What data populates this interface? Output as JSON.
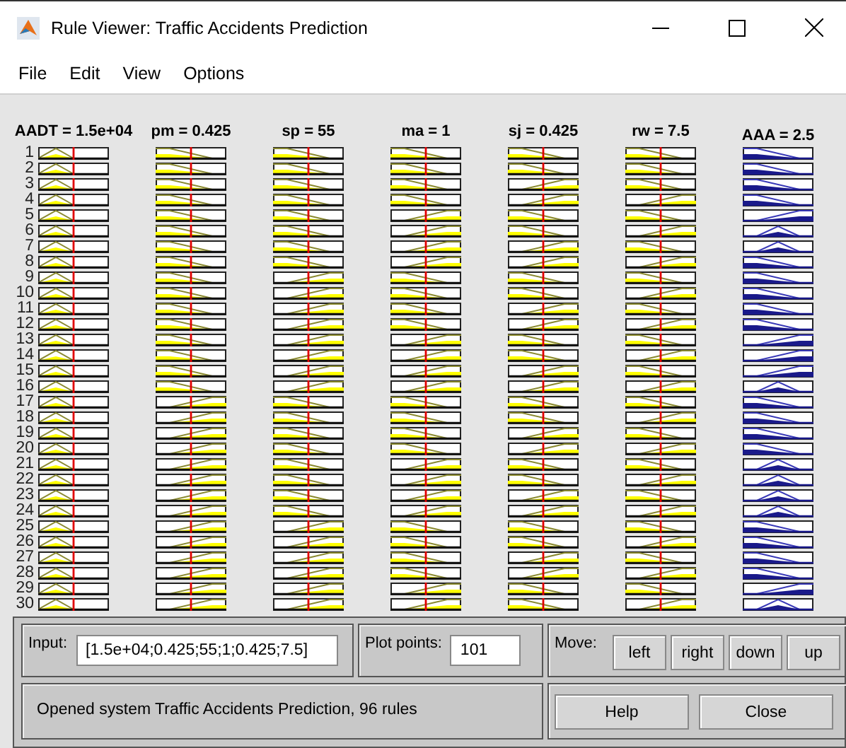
{
  "window": {
    "title": "Rule Viewer: Traffic Accidents Prediction"
  },
  "menu": [
    "File",
    "Edit",
    "View",
    "Options"
  ],
  "variables": [
    {
      "label": "AADT = 1.5e+04",
      "kind": "input",
      "level": 0.5
    },
    {
      "label": "pm = 0.425",
      "kind": "input",
      "level": 0.5
    },
    {
      "label": "sp = 55",
      "kind": "input",
      "level": 0.5
    },
    {
      "label": "ma = 1",
      "kind": "input",
      "level": 0.5
    },
    {
      "label": "sj = 0.425",
      "kind": "input",
      "level": 0.5
    },
    {
      "label": "rw = 7.5",
      "kind": "input",
      "level": 0.5
    },
    {
      "label": "AAA = 2.5",
      "kind": "output"
    }
  ],
  "rules": [
    {
      "number": "1",
      "plots": [
        {
          "kind": "tri"
        },
        {
          "kind": "lo"
        },
        {
          "kind": "lo"
        },
        {
          "kind": "lo"
        },
        {
          "kind": "lo"
        },
        {
          "kind": "lo"
        },
        {
          "kind": "lo"
        }
      ]
    },
    {
      "number": "2",
      "plots": [
        {
          "kind": "tri"
        },
        {
          "kind": "lo"
        },
        {
          "kind": "lo"
        },
        {
          "kind": "lo"
        },
        {
          "kind": "lo"
        },
        {
          "kind": "lo"
        },
        {
          "kind": "lo"
        }
      ]
    },
    {
      "number": "3",
      "plots": [
        {
          "kind": "tri"
        },
        {
          "kind": "lo"
        },
        {
          "kind": "lo"
        },
        {
          "kind": "lo"
        },
        {
          "kind": "hi"
        },
        {
          "kind": "lo"
        },
        {
          "kind": "lo"
        }
      ]
    },
    {
      "number": "4",
      "plots": [
        {
          "kind": "tri"
        },
        {
          "kind": "lo"
        },
        {
          "kind": "lo"
        },
        {
          "kind": "lo"
        },
        {
          "kind": "hi"
        },
        {
          "kind": "hi"
        },
        {
          "kind": "lo"
        }
      ]
    },
    {
      "number": "5",
      "plots": [
        {
          "kind": "tri"
        },
        {
          "kind": "lo"
        },
        {
          "kind": "lo"
        },
        {
          "kind": "hi"
        },
        {
          "kind": "lo"
        },
        {
          "kind": "lo"
        },
        {
          "kind": "hi"
        }
      ]
    },
    {
      "number": "6",
      "plots": [
        {
          "kind": "tri"
        },
        {
          "kind": "lo"
        },
        {
          "kind": "lo"
        },
        {
          "kind": "hi"
        },
        {
          "kind": "lo"
        },
        {
          "kind": "hi"
        },
        {
          "kind": "mid"
        }
      ]
    },
    {
      "number": "7",
      "plots": [
        {
          "kind": "tri"
        },
        {
          "kind": "lo"
        },
        {
          "kind": "lo"
        },
        {
          "kind": "hi"
        },
        {
          "kind": "hi"
        },
        {
          "kind": "lo"
        },
        {
          "kind": "mid"
        }
      ]
    },
    {
      "number": "8",
      "plots": [
        {
          "kind": "tri"
        },
        {
          "kind": "lo"
        },
        {
          "kind": "lo"
        },
        {
          "kind": "hi"
        },
        {
          "kind": "hi"
        },
        {
          "kind": "hi"
        },
        {
          "kind": "lo"
        }
      ]
    },
    {
      "number": "9",
      "plots": [
        {
          "kind": "tri"
        },
        {
          "kind": "lo"
        },
        {
          "kind": "hi"
        },
        {
          "kind": "lo"
        },
        {
          "kind": "lo"
        },
        {
          "kind": "lo"
        },
        {
          "kind": "lo"
        }
      ]
    },
    {
      "number": "10",
      "plots": [
        {
          "kind": "tri"
        },
        {
          "kind": "lo"
        },
        {
          "kind": "hi"
        },
        {
          "kind": "lo"
        },
        {
          "kind": "lo"
        },
        {
          "kind": "hi"
        },
        {
          "kind": "lo"
        }
      ]
    },
    {
      "number": "11",
      "plots": [
        {
          "kind": "tri"
        },
        {
          "kind": "lo"
        },
        {
          "kind": "hi"
        },
        {
          "kind": "lo"
        },
        {
          "kind": "hi"
        },
        {
          "kind": "lo"
        },
        {
          "kind": "lo"
        }
      ]
    },
    {
      "number": "12",
      "plots": [
        {
          "kind": "tri"
        },
        {
          "kind": "lo"
        },
        {
          "kind": "hi"
        },
        {
          "kind": "lo"
        },
        {
          "kind": "hi"
        },
        {
          "kind": "hi"
        },
        {
          "kind": "lo"
        }
      ]
    },
    {
      "number": "13",
      "plots": [
        {
          "kind": "tri"
        },
        {
          "kind": "lo"
        },
        {
          "kind": "hi"
        },
        {
          "kind": "hi"
        },
        {
          "kind": "lo"
        },
        {
          "kind": "lo"
        },
        {
          "kind": "hi"
        }
      ]
    },
    {
      "number": "14",
      "plots": [
        {
          "kind": "tri"
        },
        {
          "kind": "lo"
        },
        {
          "kind": "hi"
        },
        {
          "kind": "hi"
        },
        {
          "kind": "lo"
        },
        {
          "kind": "hi"
        },
        {
          "kind": "hi"
        }
      ]
    },
    {
      "number": "15",
      "plots": [
        {
          "kind": "tri"
        },
        {
          "kind": "lo"
        },
        {
          "kind": "hi"
        },
        {
          "kind": "hi"
        },
        {
          "kind": "hi"
        },
        {
          "kind": "lo"
        },
        {
          "kind": "hi"
        }
      ]
    },
    {
      "number": "16",
      "plots": [
        {
          "kind": "tri"
        },
        {
          "kind": "lo"
        },
        {
          "kind": "hi"
        },
        {
          "kind": "hi"
        },
        {
          "kind": "hi"
        },
        {
          "kind": "hi"
        },
        {
          "kind": "mid"
        }
      ]
    },
    {
      "number": "17",
      "plots": [
        {
          "kind": "tri"
        },
        {
          "kind": "hi"
        },
        {
          "kind": "lo"
        },
        {
          "kind": "lo"
        },
        {
          "kind": "lo"
        },
        {
          "kind": "lo"
        },
        {
          "kind": "lo"
        }
      ]
    },
    {
      "number": "18",
      "plots": [
        {
          "kind": "tri"
        },
        {
          "kind": "hi"
        },
        {
          "kind": "lo"
        },
        {
          "kind": "lo"
        },
        {
          "kind": "lo"
        },
        {
          "kind": "hi"
        },
        {
          "kind": "lo"
        }
      ]
    },
    {
      "number": "19",
      "plots": [
        {
          "kind": "tri"
        },
        {
          "kind": "hi"
        },
        {
          "kind": "lo"
        },
        {
          "kind": "lo"
        },
        {
          "kind": "hi"
        },
        {
          "kind": "lo"
        },
        {
          "kind": "lo"
        }
      ]
    },
    {
      "number": "20",
      "plots": [
        {
          "kind": "tri"
        },
        {
          "kind": "hi"
        },
        {
          "kind": "lo"
        },
        {
          "kind": "lo"
        },
        {
          "kind": "hi"
        },
        {
          "kind": "hi"
        },
        {
          "kind": "lo"
        }
      ]
    },
    {
      "number": "21",
      "plots": [
        {
          "kind": "tri"
        },
        {
          "kind": "hi"
        },
        {
          "kind": "lo"
        },
        {
          "kind": "hi"
        },
        {
          "kind": "lo"
        },
        {
          "kind": "lo"
        },
        {
          "kind": "mid"
        }
      ]
    },
    {
      "number": "22",
      "plots": [
        {
          "kind": "tri"
        },
        {
          "kind": "hi"
        },
        {
          "kind": "lo"
        },
        {
          "kind": "hi"
        },
        {
          "kind": "lo"
        },
        {
          "kind": "hi"
        },
        {
          "kind": "mid"
        }
      ]
    },
    {
      "number": "23",
      "plots": [
        {
          "kind": "tri"
        },
        {
          "kind": "hi"
        },
        {
          "kind": "lo"
        },
        {
          "kind": "hi"
        },
        {
          "kind": "hi"
        },
        {
          "kind": "lo"
        },
        {
          "kind": "mid"
        }
      ]
    },
    {
      "number": "24",
      "plots": [
        {
          "kind": "tri"
        },
        {
          "kind": "hi"
        },
        {
          "kind": "lo"
        },
        {
          "kind": "hi"
        },
        {
          "kind": "hi"
        },
        {
          "kind": "hi"
        },
        {
          "kind": "mid"
        }
      ]
    },
    {
      "number": "25",
      "plots": [
        {
          "kind": "tri"
        },
        {
          "kind": "hi"
        },
        {
          "kind": "hi"
        },
        {
          "kind": "lo"
        },
        {
          "kind": "lo"
        },
        {
          "kind": "lo"
        },
        {
          "kind": "lo"
        }
      ]
    },
    {
      "number": "26",
      "plots": [
        {
          "kind": "tri"
        },
        {
          "kind": "hi"
        },
        {
          "kind": "hi"
        },
        {
          "kind": "lo"
        },
        {
          "kind": "lo"
        },
        {
          "kind": "hi"
        },
        {
          "kind": "lo"
        }
      ]
    },
    {
      "number": "27",
      "plots": [
        {
          "kind": "tri"
        },
        {
          "kind": "hi"
        },
        {
          "kind": "hi"
        },
        {
          "kind": "lo"
        },
        {
          "kind": "hi"
        },
        {
          "kind": "lo"
        },
        {
          "kind": "lo"
        }
      ]
    },
    {
      "number": "28",
      "plots": [
        {
          "kind": "tri"
        },
        {
          "kind": "hi"
        },
        {
          "kind": "hi"
        },
        {
          "kind": "lo"
        },
        {
          "kind": "hi"
        },
        {
          "kind": "hi"
        },
        {
          "kind": "lo"
        }
      ]
    },
    {
      "number": "29",
      "plots": [
        {
          "kind": "tri"
        },
        {
          "kind": "hi"
        },
        {
          "kind": "hi"
        },
        {
          "kind": "hi"
        },
        {
          "kind": "lo"
        },
        {
          "kind": "lo"
        },
        {
          "kind": "hi"
        }
      ]
    },
    {
      "number": "30",
      "plots": [
        {
          "kind": "tri"
        },
        {
          "kind": "hi"
        },
        {
          "kind": "hi"
        },
        {
          "kind": "hi"
        },
        {
          "kind": "lo"
        },
        {
          "kind": "hi"
        },
        {
          "kind": "mid"
        }
      ]
    }
  ],
  "input": {
    "label": "Input:",
    "value": "[1.5e+04;0.425;55;1;0.425;7.5]"
  },
  "plot_points": {
    "label": "Plot points:",
    "value": "101"
  },
  "move": {
    "label": "Move:",
    "buttons": [
      "left",
      "right",
      "down",
      "up"
    ]
  },
  "status": "Opened system Traffic Accidents Prediction, 96 rules",
  "buttons": [
    "Help",
    "Close"
  ]
}
